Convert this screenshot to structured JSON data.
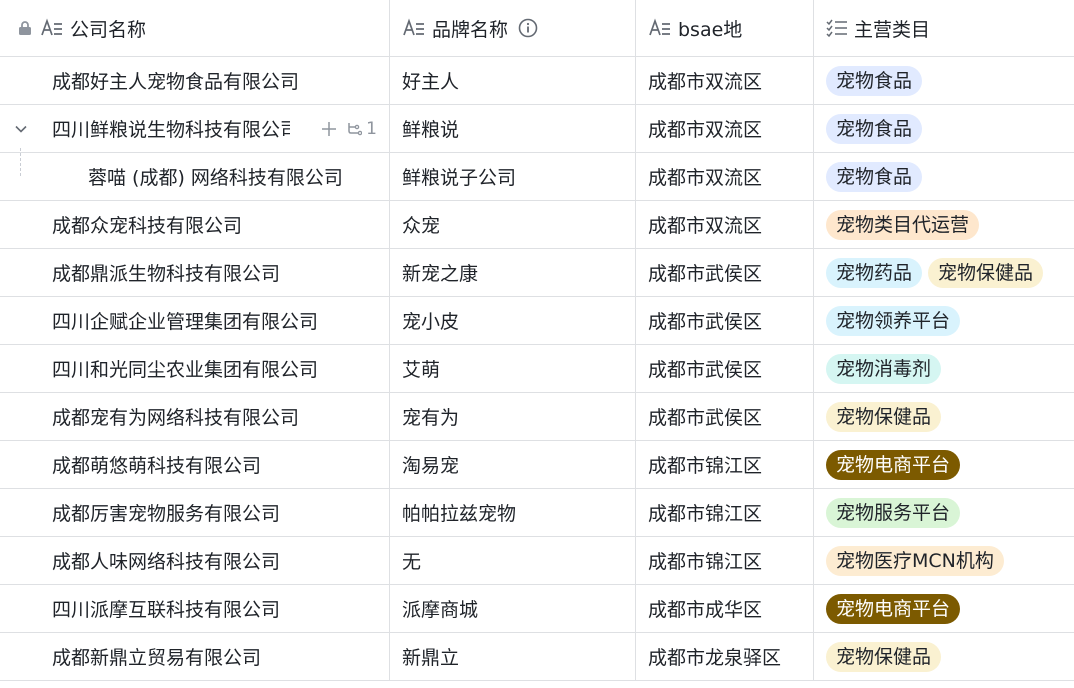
{
  "header": {
    "col_company": "公司名称",
    "col_brand": "品牌名称",
    "col_location": "bsae地",
    "col_category": "主营类目"
  },
  "icons": {
    "lock": "lock-icon",
    "text_field": "text-field-icon",
    "info": "info-icon",
    "multi_select": "multi-select-icon",
    "expand": "chevron-down-icon",
    "add": "plus-icon",
    "subrecord": "subrecord-icon"
  },
  "row_actions": {
    "sub_count": "1"
  },
  "colors": {
    "blue": "#e1eaff",
    "orange": "#fee7cd",
    "cyan": "#d9f3fd",
    "yellow": "#faf1d1",
    "teal": "#d5f6f2",
    "brown": "#7c5a00",
    "green": "#d9f5d6",
    "peach": "#fdecd2"
  },
  "rows": [
    {
      "company": "成都好主人宠物食品有限公司",
      "brand": "好主人",
      "location": "成都市双流区",
      "tags": [
        {
          "label": "宠物食品",
          "color": "blue"
        }
      ]
    },
    {
      "company": "四川鲜粮说生物科技有限公司",
      "brand": "鲜粮说",
      "location": "成都市双流区",
      "tags": [
        {
          "label": "宠物食品",
          "color": "blue"
        }
      ]
    },
    {
      "company": "蓉喵 (成都) 网络科技有限公司",
      "brand": "鲜粮说子公司",
      "location": "成都市双流区",
      "tags": [
        {
          "label": "宠物食品",
          "color": "blue"
        }
      ]
    },
    {
      "company": "成都众宠科技有限公司",
      "brand": "众宠",
      "location": "成都市双流区",
      "tags": [
        {
          "label": "宠物类目代运营",
          "color": "orange"
        }
      ]
    },
    {
      "company": "成都鼎派生物科技有限公司",
      "brand": "新宠之康",
      "location": "成都市武侯区",
      "tags": [
        {
          "label": "宠物药品",
          "color": "cyan"
        },
        {
          "label": "宠物保健品",
          "color": "yellow"
        }
      ]
    },
    {
      "company": "四川企赋企业管理集团有限公司",
      "brand": "宠小皮",
      "location": "成都市武侯区",
      "tags": [
        {
          "label": "宠物领养平台",
          "color": "cyan"
        }
      ]
    },
    {
      "company": "四川和光同尘农业集团有限公司",
      "brand": "艾萌",
      "location": "成都市武侯区",
      "tags": [
        {
          "label": "宠物消毒剂",
          "color": "teal"
        }
      ]
    },
    {
      "company": "成都宠有为网络科技有限公司",
      "brand": "宠有为",
      "location": "成都市武侯区",
      "tags": [
        {
          "label": "宠物保健品",
          "color": "yellow"
        }
      ]
    },
    {
      "company": "成都萌悠萌科技有限公司",
      "brand": "淘易宠",
      "location": "成都市锦江区",
      "tags": [
        {
          "label": "宠物电商平台",
          "color": "brown"
        }
      ]
    },
    {
      "company": "成都厉害宠物服务有限公司",
      "brand": "帕帕拉兹宠物",
      "location": "成都市锦江区",
      "tags": [
        {
          "label": "宠物服务平台",
          "color": "green"
        }
      ]
    },
    {
      "company": "成都人味网络科技有限公司",
      "brand": "无",
      "location": "成都市锦江区",
      "tags": [
        {
          "label": "宠物医疗MCN机构",
          "color": "peach"
        }
      ]
    },
    {
      "company": "四川派摩互联科技有限公司",
      "brand": "派摩商城",
      "location": "成都市成华区",
      "tags": [
        {
          "label": "宠物电商平台",
          "color": "brown"
        }
      ]
    },
    {
      "company": "成都新鼎立贸易有限公司",
      "brand": "新鼎立",
      "location": "成都市龙泉驿区",
      "tags": [
        {
          "label": "宠物保健品",
          "color": "yellow"
        }
      ]
    }
  ]
}
